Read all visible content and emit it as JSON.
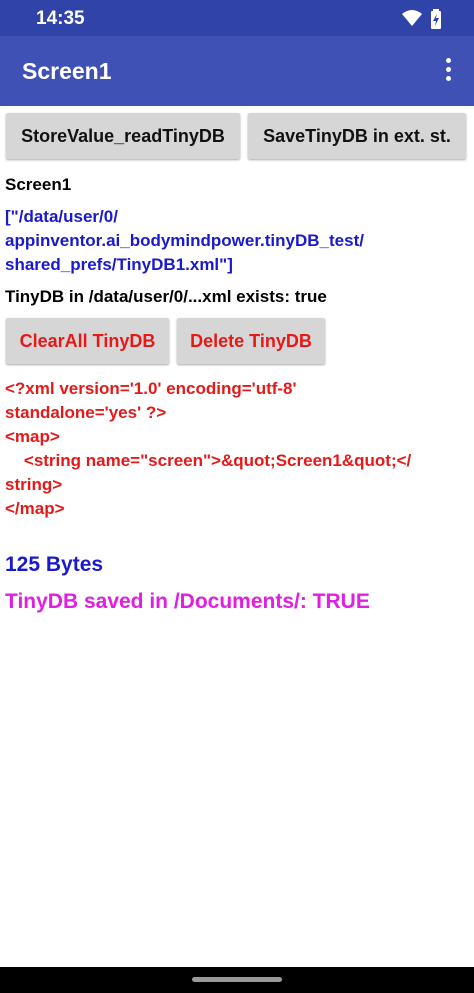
{
  "status_bar": {
    "time": "14:35",
    "icons": [
      "wifi-icon",
      "battery-icon"
    ]
  },
  "app_bar": {
    "title": "Screen1",
    "menu_icon": "more-vert-icon"
  },
  "buttons": {
    "store_value": "StoreValue_readTinyDB",
    "save_tinydb": "SaveTinyDB in ext. st.",
    "clear_all": "ClearAll TinyDB",
    "delete_tinydb": "Delete TinyDB"
  },
  "labels": {
    "screen_name": "Screen1",
    "path_line1": "[\"/data/user/0/",
    "path_line2": "appinventor.ai_bodymindpower.tinyDB_test/",
    "path_line3": "shared_prefs/TinyDB1.xml\"]",
    "exists": "TinyDB in /data/user/0/...xml exists:  true",
    "xml_lines": [
      "<?xml version='1.0' encoding='utf-8'",
      "standalone='yes' ?>",
      "<map>",
      "    <string name=\"screen\">&quot;Screen1&quot;</",
      "string>",
      "</map>"
    ],
    "bytes": "125  Bytes",
    "saved": "TinyDB saved in /Documents/:  TRUE"
  },
  "colors": {
    "status_bar": "#2f43a8",
    "app_bar": "#3f51b5",
    "button_bg": "#d6d6d6",
    "red_text": "#e61919",
    "blue_text": "#1a1acc",
    "magenta_text": "#e020e0"
  }
}
